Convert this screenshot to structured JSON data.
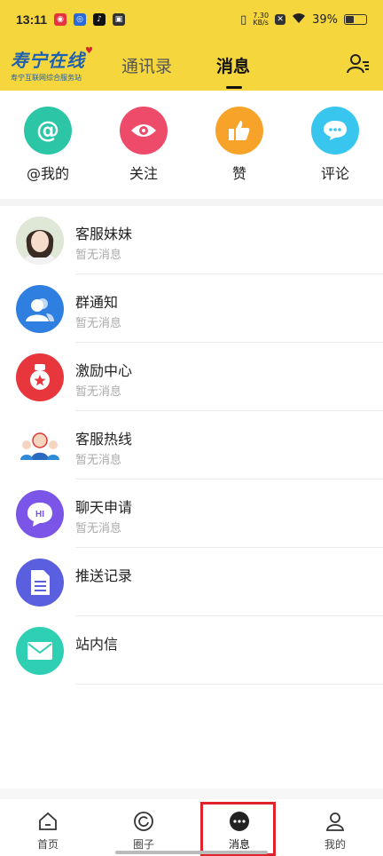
{
  "status_bar": {
    "time": "13:11",
    "network_speed": "7.30",
    "network_unit": "KB/s",
    "battery": "39%"
  },
  "header": {
    "brand_title": "寿宁在线",
    "brand_subtitle": "寿宁互联网综合服务站",
    "tabs": [
      {
        "label": "通讯录"
      },
      {
        "label": "消息"
      }
    ],
    "active_tab": "消息"
  },
  "quick_actions": [
    {
      "label": "@我的",
      "icon": "at-icon",
      "color": "#2cc6a6"
    },
    {
      "label": "关注",
      "icon": "eye-icon",
      "color": "#ee4a6a"
    },
    {
      "label": "赞",
      "icon": "thumbs-up-icon",
      "color": "#f7a32a"
    },
    {
      "label": "评论",
      "icon": "comment-icon",
      "color": "#38c6ee"
    }
  ],
  "messages": [
    {
      "title": "客服妹妹",
      "subtitle": "暂无消息",
      "icon": "avatar-photo"
    },
    {
      "title": "群通知",
      "subtitle": "暂无消息",
      "icon": "group-icon"
    },
    {
      "title": "激励中心",
      "subtitle": "暂无消息",
      "icon": "medal-icon"
    },
    {
      "title": "客服热线",
      "subtitle": "暂无消息",
      "icon": "hotline-icon"
    },
    {
      "title": "聊天申请",
      "subtitle": "暂无消息",
      "icon": "chat-hi-icon"
    },
    {
      "title": "推送记录",
      "subtitle": "",
      "icon": "document-icon"
    },
    {
      "title": "站内信",
      "subtitle": "",
      "icon": "mail-icon"
    }
  ],
  "bottom_nav": [
    {
      "label": "首页",
      "icon": "home-icon"
    },
    {
      "label": "圈子",
      "icon": "circle-icon"
    },
    {
      "label": "消息",
      "icon": "message-icon"
    },
    {
      "label": "我的",
      "icon": "profile-icon"
    }
  ],
  "chat_hi_text": "HI"
}
